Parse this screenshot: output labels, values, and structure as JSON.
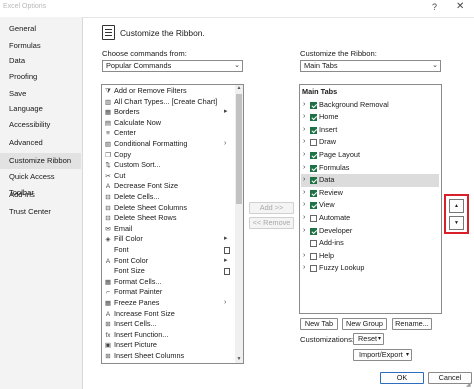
{
  "window": {
    "title": "Excel Options",
    "help_glyph": "?",
    "close_glyph": "✕"
  },
  "nav": {
    "items": [
      {
        "label": "General"
      },
      {
        "label": "Formulas"
      },
      {
        "label": "Data"
      },
      {
        "label": "Proofing"
      },
      {
        "label": "Save"
      },
      {
        "label": "Language"
      },
      {
        "label": "Accessibility"
      },
      {
        "label": "Advanced"
      },
      {
        "label": "Customize Ribbon",
        "active": true
      },
      {
        "label": "Quick Access Toolbar"
      },
      {
        "label": "Add-ins"
      },
      {
        "label": "Trust Center"
      }
    ]
  },
  "header": {
    "title": "Customize the Ribbon."
  },
  "left": {
    "label": "Choose commands from:",
    "dropdown_value": "Popular Commands",
    "commands": [
      {
        "icon": "add-remove-filter-icon",
        "label": "Add or Remove Filters"
      },
      {
        "icon": "all-chart-types-icon",
        "label": "All Chart Types... [Create Chart]"
      },
      {
        "icon": "borders-icon",
        "label": "Borders",
        "sub": "|>"
      },
      {
        "icon": "calculate-now-icon",
        "label": "Calculate Now"
      },
      {
        "icon": "center-icon",
        "label": "Center"
      },
      {
        "icon": "conditional-formatting-icon",
        "label": "Conditional Formatting",
        "sub": ">"
      },
      {
        "icon": "copy-icon",
        "label": "Copy"
      },
      {
        "icon": "custom-sort-icon",
        "label": "Custom Sort..."
      },
      {
        "icon": "cut-icon",
        "label": "Cut"
      },
      {
        "icon": "decrease-font-size-icon",
        "label": "Decrease Font Size"
      },
      {
        "icon": "delete-cells-icon",
        "label": "Delete Cells..."
      },
      {
        "icon": "delete-sheet-columns-icon",
        "label": "Delete Sheet Columns"
      },
      {
        "icon": "delete-sheet-rows-icon",
        "label": "Delete Sheet Rows"
      },
      {
        "icon": "email-icon",
        "label": "Email"
      },
      {
        "icon": "fill-color-icon",
        "label": "Fill Color",
        "sub": "|>"
      },
      {
        "icon": "",
        "label": "Font",
        "subbox": true
      },
      {
        "icon": "font-color-icon",
        "label": "Font Color",
        "sub": "|>"
      },
      {
        "icon": "",
        "label": "Font Size",
        "subbox": true
      },
      {
        "icon": "format-cells-icon",
        "label": "Format Cells..."
      },
      {
        "icon": "format-painter-icon",
        "label": "Format Painter"
      },
      {
        "icon": "freeze-panes-icon",
        "label": "Freeze Panes",
        "sub": ">"
      },
      {
        "icon": "increase-font-size-icon",
        "label": "Increase Font Size"
      },
      {
        "icon": "insert-cells-icon",
        "label": "Insert Cells..."
      },
      {
        "icon": "insert-function-icon",
        "label": "Insert Function..."
      },
      {
        "icon": "insert-picture-icon",
        "label": "Insert Picture"
      },
      {
        "icon": "insert-sheet-columns-icon",
        "label": "Insert Sheet Columns"
      }
    ]
  },
  "middle": {
    "add_label": "Add >>",
    "remove_label": "<< Remove"
  },
  "right": {
    "label": "Customize the Ribbon:",
    "dropdown_value": "Main Tabs",
    "tree": [
      {
        "label": "Main Tabs",
        "head": true
      },
      {
        "label": "Background Removal",
        "checked": true
      },
      {
        "label": "Home",
        "checked": true
      },
      {
        "label": "Insert",
        "checked": true
      },
      {
        "label": "Draw",
        "checked": false
      },
      {
        "label": "Page Layout",
        "checked": true
      },
      {
        "label": "Formulas",
        "checked": true
      },
      {
        "label": "Data",
        "checked": true,
        "selected": true
      },
      {
        "label": "Review",
        "checked": true
      },
      {
        "label": "View",
        "checked": true
      },
      {
        "label": "Automate",
        "checked": false
      },
      {
        "label": "Developer",
        "checked": true
      },
      {
        "label": "Add-ins",
        "checked": false,
        "no_expander": true
      },
      {
        "label": "Help",
        "checked": false
      },
      {
        "label": "Fuzzy Lookup",
        "checked": false
      }
    ],
    "new_tab_label": "New Tab",
    "new_group_label": "New Group",
    "rename_label": "Rename...",
    "customizations_label": "Customizations:",
    "reset_label": "Reset",
    "import_export_label": "Import/Export"
  },
  "move": {
    "up_glyph": "▲",
    "down_glyph": "▼"
  },
  "footer": {
    "ok_label": "OK",
    "cancel_label": "Cancel"
  },
  "accent_color": "#1e7145",
  "highlight_color": "#d9202a"
}
